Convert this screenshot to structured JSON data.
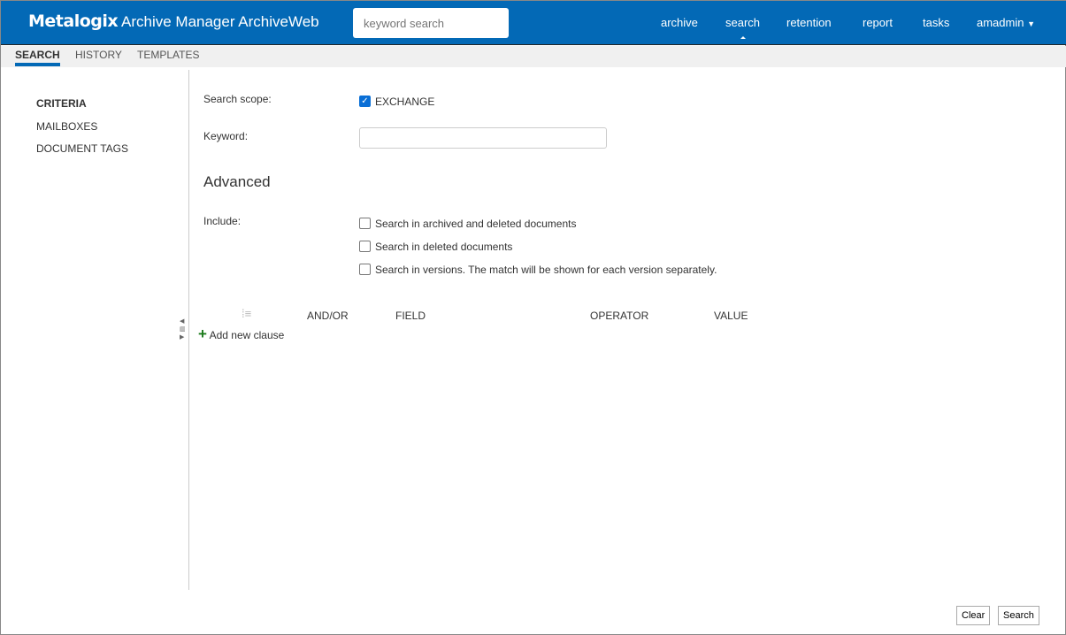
{
  "header": {
    "logo": "Metalogix",
    "title": "Archive Manager ArchiveWeb",
    "search_placeholder": "keyword search",
    "nav": [
      "archive",
      "search",
      "retention",
      "report",
      "tasks",
      "amadmin"
    ]
  },
  "subtabs": [
    "SEARCH",
    "HISTORY",
    "TEMPLATES"
  ],
  "sidebar": [
    "CRITERIA",
    "MAILBOXES",
    "DOCUMENT TAGS"
  ],
  "form": {
    "scope_label": "Search scope:",
    "scope_value": "EXCHANGE",
    "keyword_label": "Keyword:",
    "keyword_value": "",
    "advanced": "Advanced",
    "include_label": "Include:",
    "include_options": [
      "Search in archived and deleted documents",
      "Search in deleted documents",
      "Search in versions. The match will be shown for each version separately."
    ]
  },
  "clauses": {
    "columns": [
      "AND/OR",
      "FIELD",
      "OPERATOR",
      "VALUE"
    ],
    "add": "Add new clause"
  },
  "buttons": {
    "clear": "Clear",
    "search": "Search"
  }
}
